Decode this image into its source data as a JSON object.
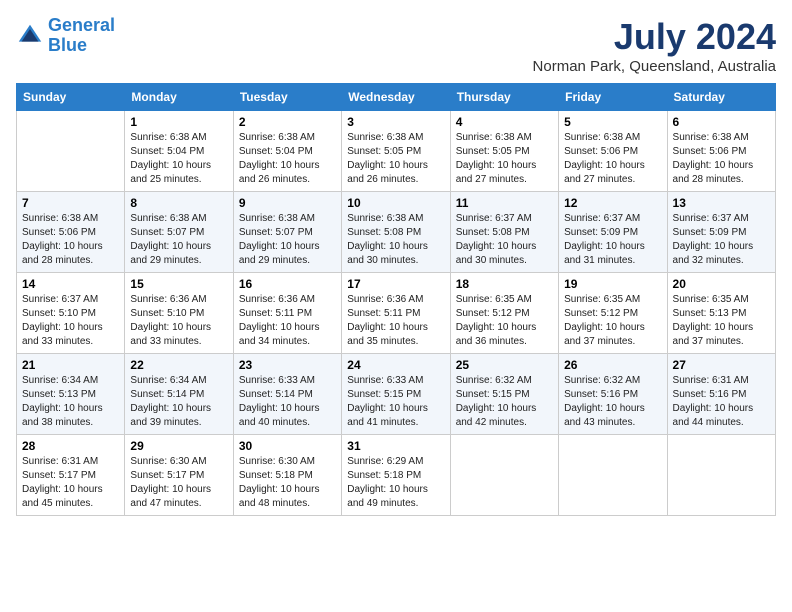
{
  "header": {
    "logo_line1": "General",
    "logo_line2": "Blue",
    "month_year": "July 2024",
    "location": "Norman Park, Queensland, Australia"
  },
  "weekdays": [
    "Sunday",
    "Monday",
    "Tuesday",
    "Wednesday",
    "Thursday",
    "Friday",
    "Saturday"
  ],
  "weeks": [
    [
      {
        "day": "",
        "sunrise": "",
        "sunset": "",
        "daylight": ""
      },
      {
        "day": "1",
        "sunrise": "Sunrise: 6:38 AM",
        "sunset": "Sunset: 5:04 PM",
        "daylight": "Daylight: 10 hours and 25 minutes."
      },
      {
        "day": "2",
        "sunrise": "Sunrise: 6:38 AM",
        "sunset": "Sunset: 5:04 PM",
        "daylight": "Daylight: 10 hours and 26 minutes."
      },
      {
        "day": "3",
        "sunrise": "Sunrise: 6:38 AM",
        "sunset": "Sunset: 5:05 PM",
        "daylight": "Daylight: 10 hours and 26 minutes."
      },
      {
        "day": "4",
        "sunrise": "Sunrise: 6:38 AM",
        "sunset": "Sunset: 5:05 PM",
        "daylight": "Daylight: 10 hours and 27 minutes."
      },
      {
        "day": "5",
        "sunrise": "Sunrise: 6:38 AM",
        "sunset": "Sunset: 5:06 PM",
        "daylight": "Daylight: 10 hours and 27 minutes."
      },
      {
        "day": "6",
        "sunrise": "Sunrise: 6:38 AM",
        "sunset": "Sunset: 5:06 PM",
        "daylight": "Daylight: 10 hours and 28 minutes."
      }
    ],
    [
      {
        "day": "7",
        "sunrise": "Sunrise: 6:38 AM",
        "sunset": "Sunset: 5:06 PM",
        "daylight": "Daylight: 10 hours and 28 minutes."
      },
      {
        "day": "8",
        "sunrise": "Sunrise: 6:38 AM",
        "sunset": "Sunset: 5:07 PM",
        "daylight": "Daylight: 10 hours and 29 minutes."
      },
      {
        "day": "9",
        "sunrise": "Sunrise: 6:38 AM",
        "sunset": "Sunset: 5:07 PM",
        "daylight": "Daylight: 10 hours and 29 minutes."
      },
      {
        "day": "10",
        "sunrise": "Sunrise: 6:38 AM",
        "sunset": "Sunset: 5:08 PM",
        "daylight": "Daylight: 10 hours and 30 minutes."
      },
      {
        "day": "11",
        "sunrise": "Sunrise: 6:37 AM",
        "sunset": "Sunset: 5:08 PM",
        "daylight": "Daylight: 10 hours and 30 minutes."
      },
      {
        "day": "12",
        "sunrise": "Sunrise: 6:37 AM",
        "sunset": "Sunset: 5:09 PM",
        "daylight": "Daylight: 10 hours and 31 minutes."
      },
      {
        "day": "13",
        "sunrise": "Sunrise: 6:37 AM",
        "sunset": "Sunset: 5:09 PM",
        "daylight": "Daylight: 10 hours and 32 minutes."
      }
    ],
    [
      {
        "day": "14",
        "sunrise": "Sunrise: 6:37 AM",
        "sunset": "Sunset: 5:10 PM",
        "daylight": "Daylight: 10 hours and 33 minutes."
      },
      {
        "day": "15",
        "sunrise": "Sunrise: 6:36 AM",
        "sunset": "Sunset: 5:10 PM",
        "daylight": "Daylight: 10 hours and 33 minutes."
      },
      {
        "day": "16",
        "sunrise": "Sunrise: 6:36 AM",
        "sunset": "Sunset: 5:11 PM",
        "daylight": "Daylight: 10 hours and 34 minutes."
      },
      {
        "day": "17",
        "sunrise": "Sunrise: 6:36 AM",
        "sunset": "Sunset: 5:11 PM",
        "daylight": "Daylight: 10 hours and 35 minutes."
      },
      {
        "day": "18",
        "sunrise": "Sunrise: 6:35 AM",
        "sunset": "Sunset: 5:12 PM",
        "daylight": "Daylight: 10 hours and 36 minutes."
      },
      {
        "day": "19",
        "sunrise": "Sunrise: 6:35 AM",
        "sunset": "Sunset: 5:12 PM",
        "daylight": "Daylight: 10 hours and 37 minutes."
      },
      {
        "day": "20",
        "sunrise": "Sunrise: 6:35 AM",
        "sunset": "Sunset: 5:13 PM",
        "daylight": "Daylight: 10 hours and 37 minutes."
      }
    ],
    [
      {
        "day": "21",
        "sunrise": "Sunrise: 6:34 AM",
        "sunset": "Sunset: 5:13 PM",
        "daylight": "Daylight: 10 hours and 38 minutes."
      },
      {
        "day": "22",
        "sunrise": "Sunrise: 6:34 AM",
        "sunset": "Sunset: 5:14 PM",
        "daylight": "Daylight: 10 hours and 39 minutes."
      },
      {
        "day": "23",
        "sunrise": "Sunrise: 6:33 AM",
        "sunset": "Sunset: 5:14 PM",
        "daylight": "Daylight: 10 hours and 40 minutes."
      },
      {
        "day": "24",
        "sunrise": "Sunrise: 6:33 AM",
        "sunset": "Sunset: 5:15 PM",
        "daylight": "Daylight: 10 hours and 41 minutes."
      },
      {
        "day": "25",
        "sunrise": "Sunrise: 6:32 AM",
        "sunset": "Sunset: 5:15 PM",
        "daylight": "Daylight: 10 hours and 42 minutes."
      },
      {
        "day": "26",
        "sunrise": "Sunrise: 6:32 AM",
        "sunset": "Sunset: 5:16 PM",
        "daylight": "Daylight: 10 hours and 43 minutes."
      },
      {
        "day": "27",
        "sunrise": "Sunrise: 6:31 AM",
        "sunset": "Sunset: 5:16 PM",
        "daylight": "Daylight: 10 hours and 44 minutes."
      }
    ],
    [
      {
        "day": "28",
        "sunrise": "Sunrise: 6:31 AM",
        "sunset": "Sunset: 5:17 PM",
        "daylight": "Daylight: 10 hours and 45 minutes."
      },
      {
        "day": "29",
        "sunrise": "Sunrise: 6:30 AM",
        "sunset": "Sunset: 5:17 PM",
        "daylight": "Daylight: 10 hours and 47 minutes."
      },
      {
        "day": "30",
        "sunrise": "Sunrise: 6:30 AM",
        "sunset": "Sunset: 5:18 PM",
        "daylight": "Daylight: 10 hours and 48 minutes."
      },
      {
        "day": "31",
        "sunrise": "Sunrise: 6:29 AM",
        "sunset": "Sunset: 5:18 PM",
        "daylight": "Daylight: 10 hours and 49 minutes."
      },
      {
        "day": "",
        "sunrise": "",
        "sunset": "",
        "daylight": ""
      },
      {
        "day": "",
        "sunrise": "",
        "sunset": "",
        "daylight": ""
      },
      {
        "day": "",
        "sunrise": "",
        "sunset": "",
        "daylight": ""
      }
    ]
  ]
}
